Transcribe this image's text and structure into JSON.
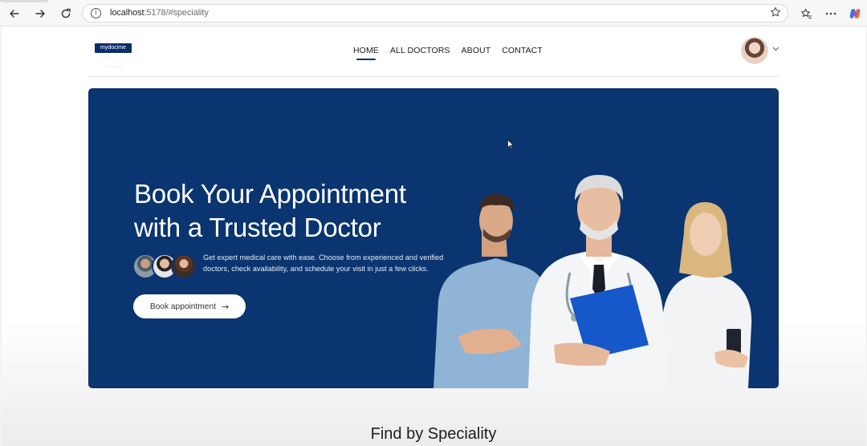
{
  "browser": {
    "url_host": "localhost",
    "url_rest": ":5178/#speciality",
    "icons": [
      "back-icon",
      "forward-icon",
      "refresh-icon",
      "info-icon",
      "star-icon",
      "favorites-icon",
      "more-icon",
      "copilot-icon"
    ]
  },
  "navbar": {
    "logo_text": "mydocime",
    "items": [
      {
        "label": "HOME",
        "active": true
      },
      {
        "label": "ALL DOCTORS",
        "active": false
      },
      {
        "label": "ABOUT",
        "active": false
      },
      {
        "label": "CONTACT",
        "active": false
      }
    ]
  },
  "hero": {
    "title_line1": "Book Your Appointment",
    "title_line2": "with a Trusted Doctor",
    "subtitle": "Get expert medical care with ease. Choose from experienced and verified doctors, check availability, and schedule your visit in just a few clicks.",
    "button_label": "Book appointment",
    "button_arrow": "→"
  },
  "section": {
    "title": "Find by Speciality"
  },
  "colors": {
    "primary": "#0a3570",
    "logo_bg": "#0a2d6a"
  }
}
